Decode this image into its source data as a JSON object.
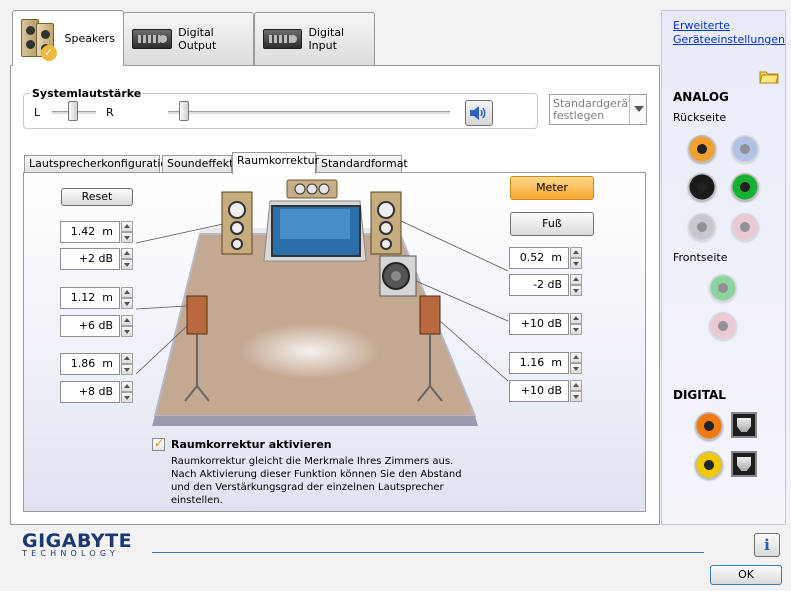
{
  "top_tabs": [
    {
      "label": "Speakers",
      "active": true,
      "icon": "speakers-icon"
    },
    {
      "label": "Digital Output",
      "active": false,
      "icon": "digital-output-device-icon"
    },
    {
      "label": "Digital Input",
      "active": false,
      "icon": "digital-input-device-icon"
    }
  ],
  "volume": {
    "legend": "Systemlautstärke",
    "left_label": "L",
    "right_label": "R"
  },
  "default_device": {
    "label": "Standardgerät festlegen"
  },
  "inner_tabs": [
    {
      "label": "Lautsprecherkonfiguration",
      "active": false
    },
    {
      "label": "Soundeffekt",
      "active": false
    },
    {
      "label": "Raumkorrektur",
      "active": true
    },
    {
      "label": "Standardformat",
      "active": false
    }
  ],
  "room": {
    "reset_label": "Reset",
    "meter_label": "Meter",
    "feet_label": "Fuß",
    "left_fields": [
      {
        "distance": "1.42",
        "gain": "+2",
        "unit_dist": "m",
        "unit_gain": "dB"
      },
      {
        "distance": "1.12",
        "gain": "+6",
        "unit_dist": "m",
        "unit_gain": "dB"
      },
      {
        "distance": "1.86",
        "gain": "+8",
        "unit_dist": "m",
        "unit_gain": "dB"
      }
    ],
    "right_fields": [
      {
        "distance": "0.52",
        "gain": "-2",
        "unit_dist": "m",
        "unit_gain": "dB"
      },
      {
        "gain": "+10",
        "unit_gain": "dB"
      },
      {
        "distance": "1.16",
        "gain": "+10",
        "unit_dist": "m",
        "unit_gain": "dB"
      }
    ],
    "enable_checkbox": {
      "label": "Raumkorrektur aktivieren",
      "checked": true
    },
    "description": "Raumkorrektur gleicht die Merkmale Ihres Zimmers aus. Nach Aktivierung dieser Funktion können Sie den Abstand und den Verstärkungsgrad der einzelnen Lautsprecher einstellen."
  },
  "side": {
    "link": "Erweiterte Geräteeinstellungen",
    "analog_heading": "ANALOG",
    "rear_label": "Rückseite",
    "front_label": "Frontseite",
    "digital_heading": "DIGITAL"
  },
  "footer": {
    "brand": "GIGABYTE",
    "brand_sub": "TECHNOLOGY",
    "ok_label": "OK"
  },
  "colors": {
    "orange": "#f0a030",
    "blue": "#6a8fd0",
    "black": "#1a1a1a",
    "green": "#18b030",
    "gray": "#9a9a9a",
    "pink": "#e89aa8",
    "yellow": "#f0c800",
    "link": "#0033cc"
  }
}
